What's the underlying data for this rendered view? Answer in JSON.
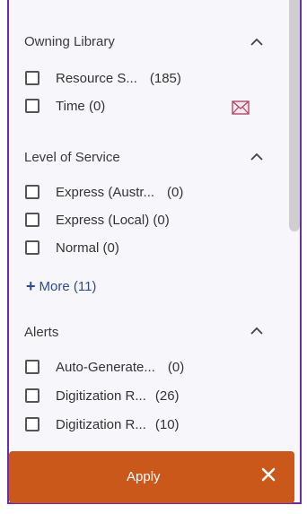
{
  "sections": {
    "owning_library": {
      "title": "Owning Library",
      "items": [
        {
          "label": "Resource S...",
          "count": "(185)"
        },
        {
          "label": "Time (0)",
          "count": ""
        }
      ]
    },
    "level_of_service": {
      "title": "Level of Service",
      "items": [
        {
          "label": "Express (Austr...",
          "count": "(0)"
        },
        {
          "label": "Express (Local) (0)",
          "count": ""
        },
        {
          "label": "Normal (0)",
          "count": ""
        }
      ],
      "more": "More (11)"
    },
    "alerts": {
      "title": "Alerts",
      "items": [
        {
          "label": "Auto-Generate...",
          "count": "(0)"
        },
        {
          "label": "Digitization R...",
          "count": "(26)"
        },
        {
          "label": "Digitization R...",
          "count": "(10)"
        }
      ]
    }
  },
  "footer": {
    "apply_label": "Apply",
    "close_icon": "close-icon"
  },
  "icons": {
    "caret": "chevron-up-icon",
    "mail": "mail-icon"
  },
  "colors": {
    "panel_border": "#6a2fa8",
    "apply_bg": "#c9581a",
    "more_link": "#2b4d8f"
  }
}
